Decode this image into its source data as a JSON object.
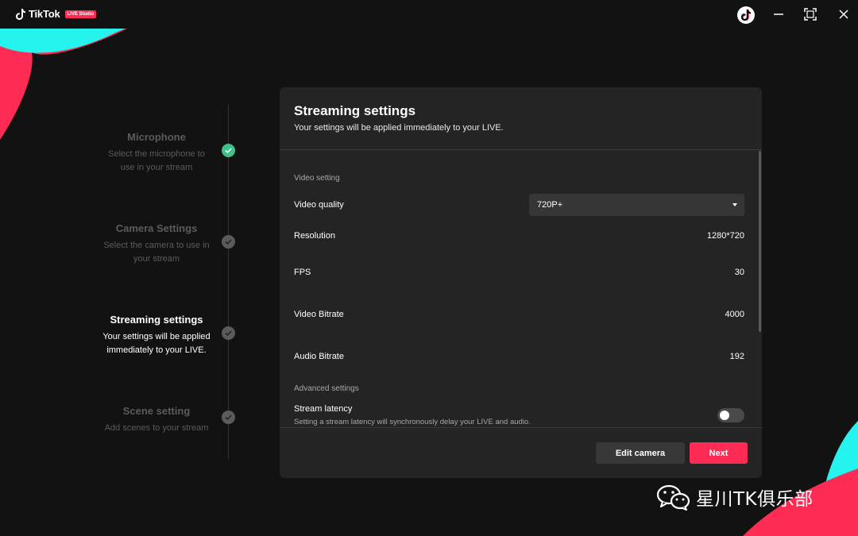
{
  "app": {
    "name": "TikTok",
    "badge": "LIVE Studio"
  },
  "titlebar": {
    "icons": [
      "tiktok-avatar-icon",
      "minimize-icon",
      "maximize-icon",
      "close-icon"
    ]
  },
  "colors": {
    "accent": "#fe2c55",
    "cyan": "#25f4ee",
    "done": "#3ac48c",
    "background": "#121212",
    "panel": "#242424"
  },
  "steps": [
    {
      "title": "Microphone",
      "desc1": "Select the microphone to",
      "desc2": "use in your stream",
      "status": "done"
    },
    {
      "title": "Camera Settings",
      "desc1": "Select the camera to use in",
      "desc2": "your stream",
      "status": "pending"
    },
    {
      "title": "Streaming settings",
      "desc1": "Your settings will be applied",
      "desc2": "immediately to your LIVE.",
      "status": "active"
    },
    {
      "title": "Scene setting",
      "desc1": "Add scenes to your stream",
      "desc2": "",
      "status": "pending"
    }
  ],
  "panel": {
    "title": "Streaming settings",
    "subtitle": "Your settings will be applied immediately to your LIVE.",
    "video_section": "Video setting",
    "video_quality": {
      "label": "Video quality",
      "value": "720P+"
    },
    "resolution": {
      "label": "Resolution",
      "value": "1280*720"
    },
    "fps": {
      "label": "FPS",
      "value": "30"
    },
    "video_bitrate": {
      "label": "Video Bitrate",
      "value": "4000"
    },
    "audio_bitrate": {
      "label": "Audio Bitrate",
      "value": "192"
    },
    "advanced_section": "Advanced settings",
    "stream_latency": {
      "label": "Stream latency",
      "desc": "Setting a stream latency will synchronously delay your LIVE and audio.",
      "enabled": false
    },
    "buttons": {
      "edit_camera": "Edit camera",
      "next": "Next"
    }
  },
  "watermark": {
    "text": "星川TK俱乐部"
  }
}
